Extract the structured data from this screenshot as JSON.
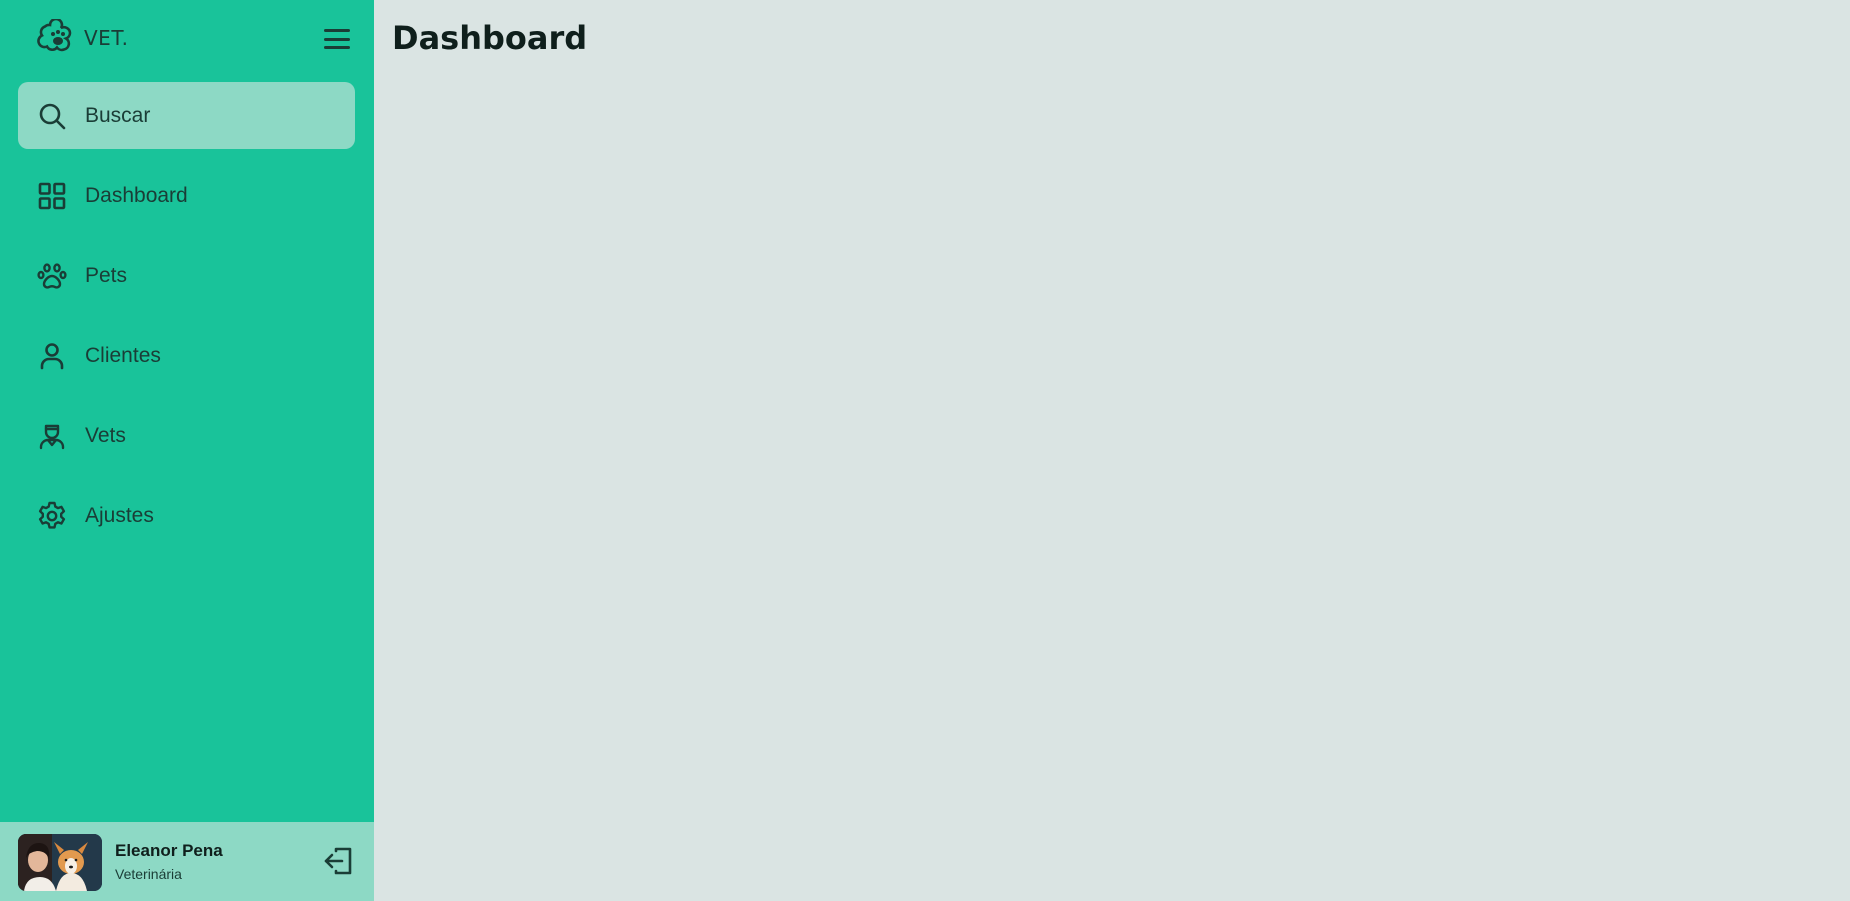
{
  "brand": {
    "name": "VET.",
    "icon": "paw-logo-icon"
  },
  "menu_toggle": {
    "icon": "hamburger-icon"
  },
  "nav": {
    "items": [
      {
        "label": "Buscar",
        "icon": "search-icon",
        "active": true
      },
      {
        "label": "Dashboard",
        "icon": "grid-icon",
        "active": false
      },
      {
        "label": "Pets",
        "icon": "paw-icon",
        "active": false
      },
      {
        "label": "Clientes",
        "icon": "user-icon",
        "active": false
      },
      {
        "label": "Vets",
        "icon": "vet-icon",
        "active": false
      },
      {
        "label": "Ajustes",
        "icon": "gear-icon",
        "active": false
      }
    ]
  },
  "profile": {
    "name": "Eleanor Pena",
    "role": "Veterinária",
    "avatar": "avatar-photo",
    "logout_icon": "logout-icon"
  },
  "main": {
    "title": "Dashboard"
  },
  "colors": {
    "sidebar": "#19c39a",
    "active_item": "#8dd9c5",
    "background": "#dae4e3",
    "icon": "#1a3d36"
  }
}
